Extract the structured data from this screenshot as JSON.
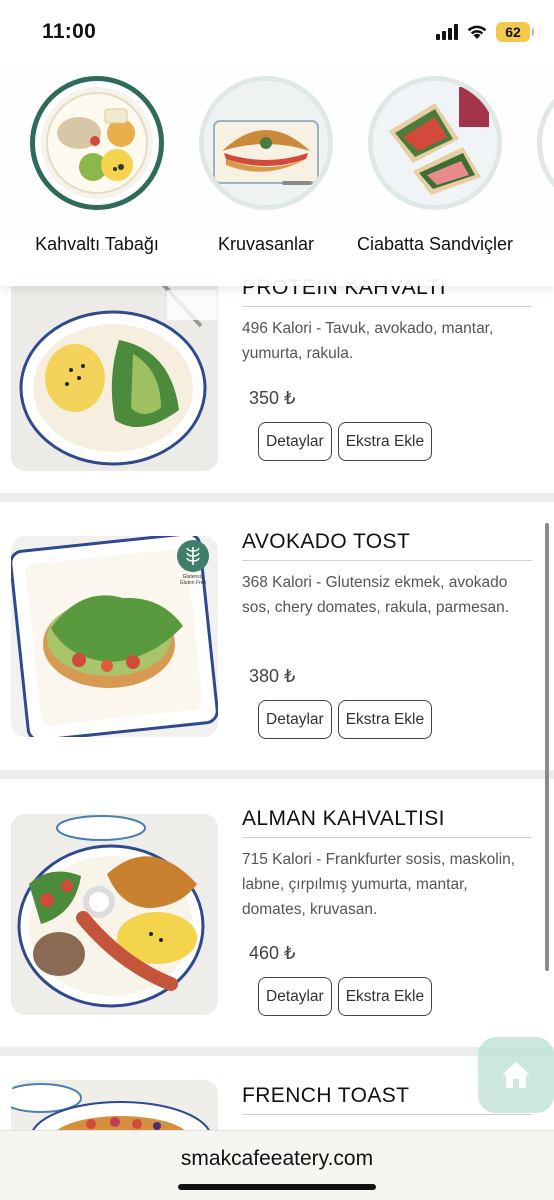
{
  "status_bar": {
    "time": "11:00",
    "battery": "62"
  },
  "categories": [
    {
      "label": "Kahvaltı Tabağı",
      "active": true
    },
    {
      "label": "Kruvasanlar",
      "active": false
    },
    {
      "label": "Ciabatta Sandviçler",
      "active": false
    }
  ],
  "menu_items": [
    {
      "title": "PROTEIN KAHVALTI",
      "description": "496 Kalori - Tavuk, avokado, mantar, yumurta, rakula.",
      "price": "350 ₺",
      "details_label": "Detaylar",
      "extra_label": "Ekstra Ekle"
    },
    {
      "title": "AVOKADO TOST",
      "description": "368 Kalori - Glutensiz ekmek, avokado sos, chery domates, rakula, parmesan.",
      "price": "380 ₺",
      "badge_line1": "Glutensiz",
      "badge_line2": "Gluten Free",
      "details_label": "Detaylar",
      "extra_label": "Ekstra Ekle"
    },
    {
      "title": "ALMAN KAHVALTISI",
      "description": "715 Kalori - Frankfurter sosis, maskolin, labne, çırpılmış yumurta, mantar, domates, kruvasan.",
      "price": "460 ₺",
      "details_label": "Detaylar",
      "extra_label": "Ekstra Ekle"
    },
    {
      "title": "FRENCH TOAST",
      "description": "",
      "price": ""
    }
  ],
  "browser": {
    "url": "smakcafeeatery.com"
  },
  "colors": {
    "accent": "#2f6b5b",
    "home_button": "#bee1d6"
  },
  "icons": [
    "signal-icon",
    "wifi-icon",
    "battery-icon",
    "home-icon"
  ]
}
